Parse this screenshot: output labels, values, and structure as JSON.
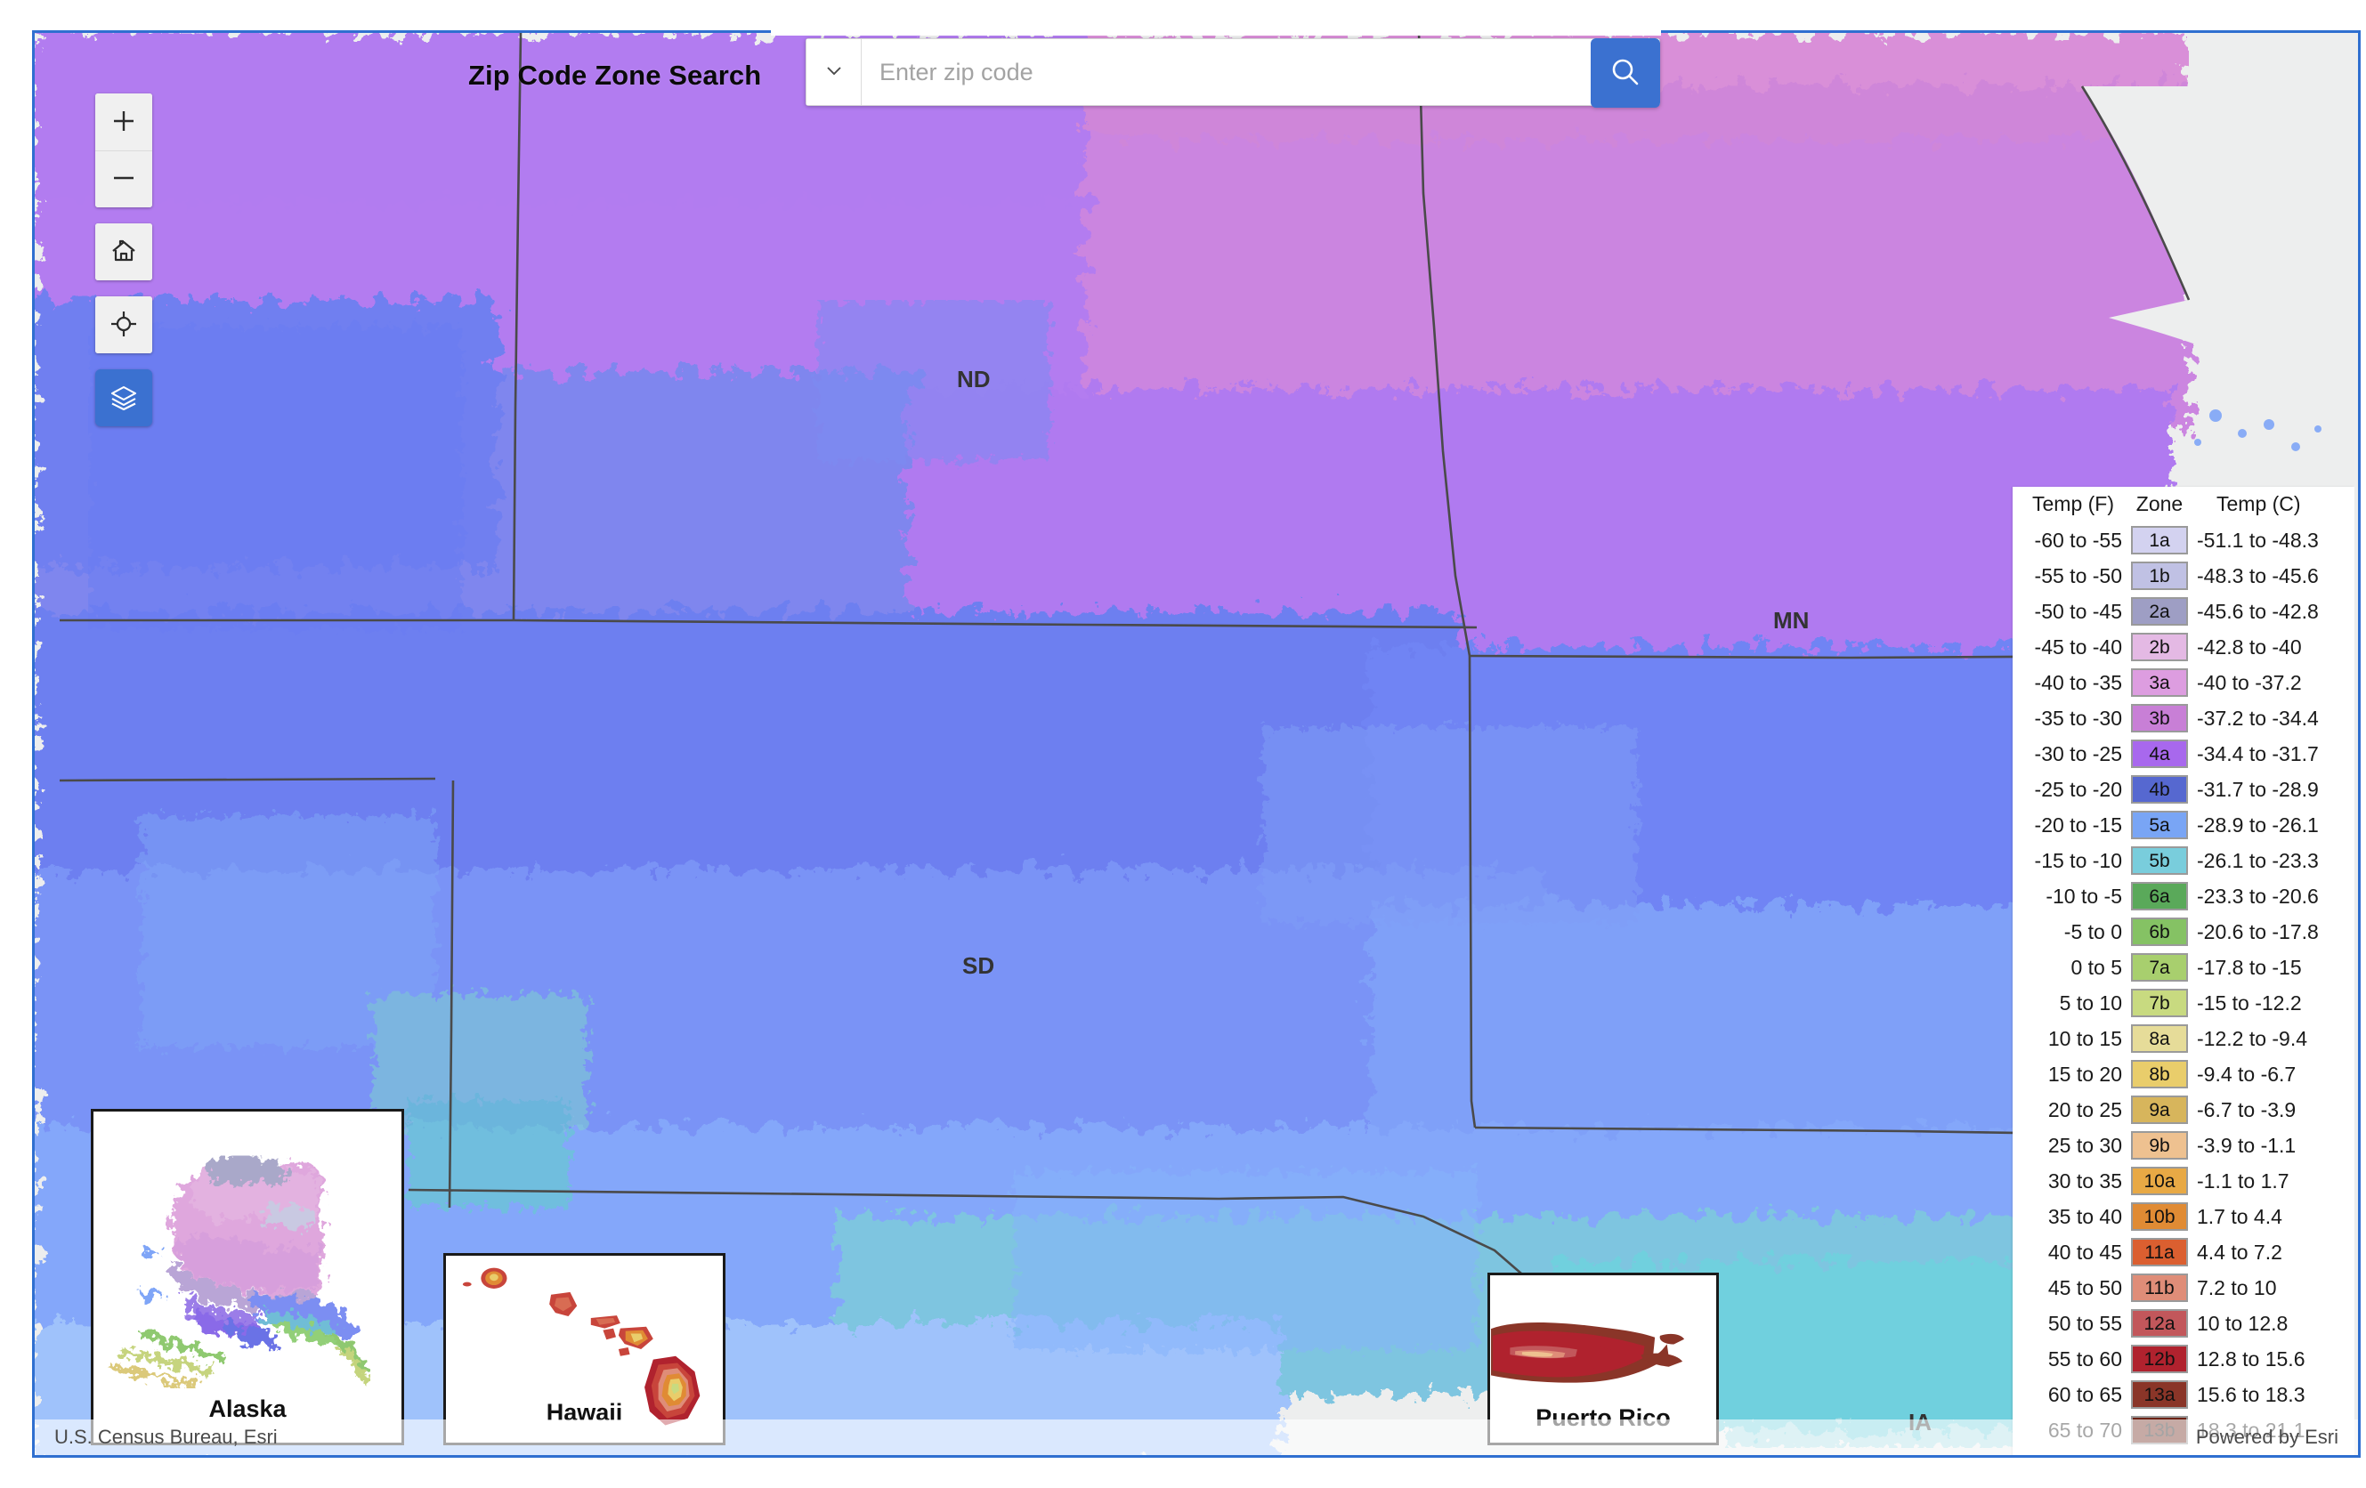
{
  "app": {
    "title": "Zip Code Zone Search"
  },
  "search": {
    "placeholder": "Enter zip code",
    "value": "",
    "source_icon": "chevron-down-icon",
    "submit_icon": "search-icon",
    "accent_color": "#3b71d0"
  },
  "map_controls": [
    {
      "name": "zoom-in",
      "icon": "plus-icon",
      "label": "Zoom in",
      "active": false
    },
    {
      "name": "zoom-out",
      "icon": "minus-icon",
      "label": "Zoom out",
      "active": false
    },
    {
      "name": "home",
      "icon": "home-icon",
      "label": "Default extent",
      "active": false
    },
    {
      "name": "locate",
      "icon": "crosshair-icon",
      "label": "Find my location",
      "active": false
    },
    {
      "name": "layers",
      "icon": "layers-icon",
      "label": "Layer list",
      "active": true
    }
  ],
  "state_labels": [
    {
      "id": "nd",
      "text": "ND"
    },
    {
      "id": "mn",
      "text": "MN"
    },
    {
      "id": "sd",
      "text": "SD"
    },
    {
      "id": "ia",
      "text": "IA"
    }
  ],
  "insets": [
    {
      "id": "alaska",
      "label": "Alaska"
    },
    {
      "id": "hawaii",
      "label": "Hawaii"
    },
    {
      "id": "puertorico",
      "label": "Puerto Rico"
    }
  ],
  "legend": {
    "headers": {
      "temp_f": "Temp (F)",
      "zone": "Zone",
      "temp_c": "Temp (C)"
    },
    "rows": [
      {
        "temp_f": "-60 to -55",
        "zone": "1a",
        "temp_c": "-51.1 to -48.3",
        "color": "#d3d2f0"
      },
      {
        "temp_f": "-55 to -50",
        "zone": "1b",
        "temp_c": "-48.3 to -45.6",
        "color": "#c0c1e4"
      },
      {
        "temp_f": "-50 to -45",
        "zone": "2a",
        "temp_c": "-45.6 to -42.8",
        "color": "#9e9ec4"
      },
      {
        "temp_f": "-45 to -40",
        "zone": "2b",
        "temp_c": "-42.8 to -40",
        "color": "#e4b9e4"
      },
      {
        "temp_f": "-40 to -35",
        "zone": "3a",
        "temp_c": "-40 to -37.2",
        "color": "#dd9de0"
      },
      {
        "temp_f": "-35 to -30",
        "zone": "3b",
        "temp_c": "-37.2 to -34.4",
        "color": "#c87fd6"
      },
      {
        "temp_f": "-30 to -25",
        "zone": "4a",
        "temp_c": "-34.4 to -31.7",
        "color": "#a868ed"
      },
      {
        "temp_f": "-25 to -20",
        "zone": "4b",
        "temp_c": "-31.7 to -28.9",
        "color": "#5668d0"
      },
      {
        "temp_f": "-20 to -15",
        "zone": "5a",
        "temp_c": "-28.9 to -26.1",
        "color": "#79a5f5"
      },
      {
        "temp_f": "-15 to -10",
        "zone": "5b",
        "temp_c": "-26.1 to -23.3",
        "color": "#79cddc"
      },
      {
        "temp_f": "-10 to -5",
        "zone": "6a",
        "temp_c": "-23.3 to -20.6",
        "color": "#5aa95a"
      },
      {
        "temp_f": "-5 to 0",
        "zone": "6b",
        "temp_c": "-20.6 to -17.8",
        "color": "#85c264"
      },
      {
        "temp_f": "0 to 5",
        "zone": "7a",
        "temp_c": "-17.8 to -15",
        "color": "#a8cf6e"
      },
      {
        "temp_f": "5 to 10",
        "zone": "7b",
        "temp_c": "-15 to -12.2",
        "color": "#c8da80"
      },
      {
        "temp_f": "10 to 15",
        "zone": "8a",
        "temp_c": "-12.2 to -9.4",
        "color": "#e6dc99"
      },
      {
        "temp_f": "15 to 20",
        "zone": "8b",
        "temp_c": "-9.4 to -6.7",
        "color": "#e9cd6b"
      },
      {
        "temp_f": "20 to 25",
        "zone": "9a",
        "temp_c": "-6.7 to -3.9",
        "color": "#d7b55c"
      },
      {
        "temp_f": "25 to 30",
        "zone": "9b",
        "temp_c": "-3.9 to -1.1",
        "color": "#eec190"
      },
      {
        "temp_f": "30 to 35",
        "zone": "10a",
        "temp_c": "-1.1 to 1.7",
        "color": "#e8a945"
      },
      {
        "temp_f": "35 to 40",
        "zone": "10b",
        "temp_c": "1.7 to 4.4",
        "color": "#e08b34"
      },
      {
        "temp_f": "40 to 45",
        "zone": "11a",
        "temp_c": "4.4 to 7.2",
        "color": "#db5f30"
      },
      {
        "temp_f": "45 to 50",
        "zone": "11b",
        "temp_c": "7.2 to 10",
        "color": "#df8d78"
      },
      {
        "temp_f": "50 to 55",
        "zone": "12a",
        "temp_c": "10 to 12.8",
        "color": "#c2575b"
      },
      {
        "temp_f": "55 to 60",
        "zone": "12b",
        "temp_c": "12.8 to 15.6",
        "color": "#b0222e"
      },
      {
        "temp_f": "60 to 65",
        "zone": "13a",
        "temp_c": "15.6 to 18.3",
        "color": "#8a3528"
      },
      {
        "temp_f": "65 to 70",
        "zone": "13b",
        "temp_c": "18.3 to 21.1",
        "color": "#6b2114"
      }
    ]
  },
  "attribution": {
    "left": "U.S. Census Bureau, Esri",
    "right": "Powered by Esri"
  }
}
